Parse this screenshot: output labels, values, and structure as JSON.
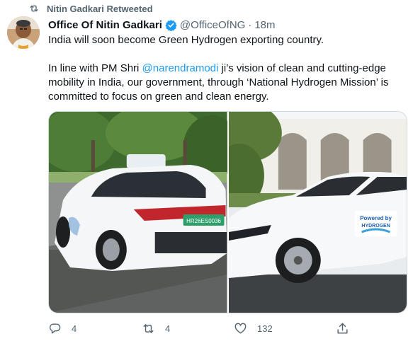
{
  "retweet_banner": {
    "text": "Nitin Gadkari Retweeted",
    "icon": "retweet-icon"
  },
  "author": {
    "display_name": "Office Of Nitin Gadkari",
    "handle": "@OfficeOfNG",
    "separator": "·",
    "time": "18m",
    "verified": true
  },
  "tweet": {
    "line1": "India will soon become Green Hydrogen exporting country.",
    "para2_before": "In line with PM Shri ",
    "mention": "@narendramodi",
    "para2_after": " ji’s vision of clean and cutting-edge mobility in India, our government, through ‘National Hydrogen Mission’ is committed to focus on green and clean energy."
  },
  "media": {
    "photos": [
      {
        "plate": "HR26ES0036"
      },
      {
        "decal_line1": "Powered by",
        "decal_line2": "HYDROGEN"
      }
    ]
  },
  "actions": {
    "reply_count": "4",
    "retweet_count": "4",
    "like_count": "132"
  },
  "colors": {
    "accent": "#1d9bf0",
    "muted": "#536471",
    "text": "#0f1419"
  }
}
